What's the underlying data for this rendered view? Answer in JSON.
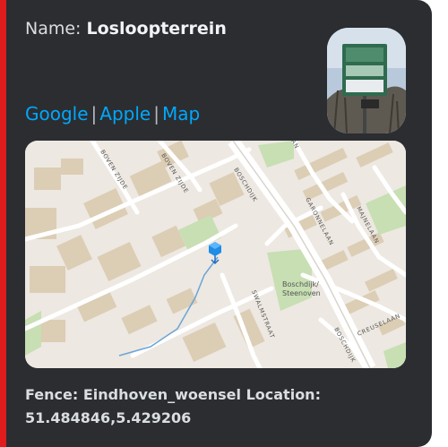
{
  "embed": {
    "name_label": "Name:",
    "name_value": "Losloopterrein",
    "links": {
      "google": "Google",
      "separator": "|",
      "apple": "Apple",
      "map": "Map"
    },
    "footer_line1": "Fence: Eindhoven_woensel Location:",
    "footer_line2": "51.484846,5.429206",
    "colors": {
      "accent": "#e01c1c",
      "card_bg": "#2b2d31",
      "link": "#00a8fc"
    }
  },
  "map": {
    "street_labels": {
      "boven_zijde_1": "BOVEN ZIJDE",
      "boven_zijde_2": "BOVEN ZIJDE",
      "boschdijk_top": "BOSCHDIJK",
      "boschdijk_bottom": "BOSCHDIJK",
      "garonnelaan": "GARONNELAAN",
      "majnelaan": "MAJNELAAN",
      "creuselaan": "CREUSELAAN",
      "swalmstraat": "SWALMSTRAAT",
      "an_top": "AN"
    },
    "place_label_line1": "Boschdijk/",
    "place_label_line2": "Steenoven",
    "marker_icon": "map-marker-icon"
  },
  "thumbnail": {
    "icon": "sign-photo"
  }
}
